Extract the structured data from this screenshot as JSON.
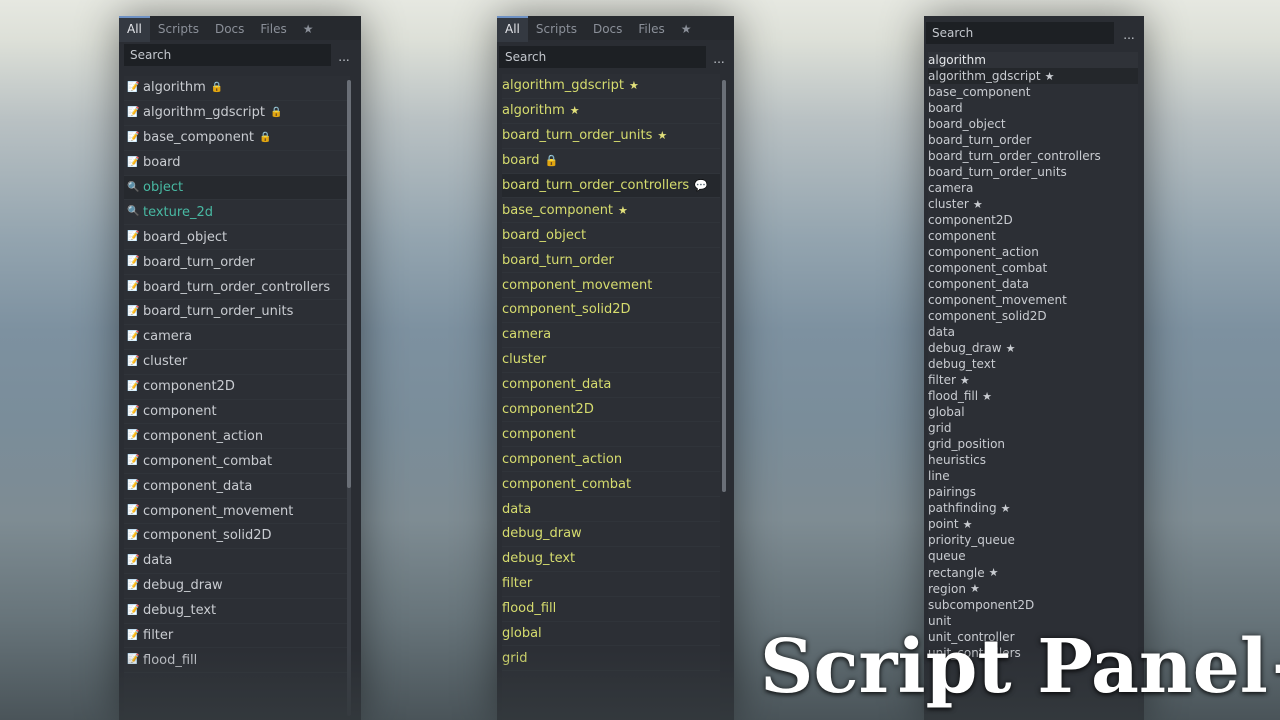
{
  "colors": {
    "panel_bg": "#2a2d33",
    "accent_tab": "#6e91c4",
    "help_teal": "#48b9a3",
    "favorite_yellow": "#d6dc6e",
    "lock_gold": "#e5c451"
  },
  "brand_title": "Script Panel+",
  "panels": [
    {
      "tabs": [
        "All",
        "Scripts",
        "Docs",
        "Files",
        "★"
      ],
      "active_tab": "All",
      "search_placeholder": "Search",
      "menu_label": "...",
      "items": [
        {
          "label": "algorithm",
          "icon": "script-icon",
          "mark": "🔒"
        },
        {
          "label": "algorithm_gdscript",
          "icon": "script-icon",
          "mark": "🔒"
        },
        {
          "label": "base_component",
          "icon": "script-icon",
          "mark": "🔒"
        },
        {
          "label": "board",
          "icon": "script-icon",
          "mark": ""
        },
        {
          "label": "object",
          "icon": "help-search-icon",
          "mark": "",
          "type": "help",
          "selected": true
        },
        {
          "label": "texture_2d",
          "icon": "help-search-icon",
          "mark": "",
          "type": "help"
        },
        {
          "label": "board_object",
          "icon": "script-icon",
          "mark": ""
        },
        {
          "label": "board_turn_order",
          "icon": "script-icon",
          "mark": ""
        },
        {
          "label": "board_turn_order_controllers",
          "icon": "script-icon",
          "mark": ""
        },
        {
          "label": "board_turn_order_units",
          "icon": "script-icon",
          "mark": ""
        },
        {
          "label": "camera",
          "icon": "script-icon",
          "mark": ""
        },
        {
          "label": "cluster",
          "icon": "script-icon",
          "mark": ""
        },
        {
          "label": "component2D",
          "icon": "script-icon",
          "mark": ""
        },
        {
          "label": "component",
          "icon": "script-icon",
          "mark": ""
        },
        {
          "label": "component_action",
          "icon": "script-icon",
          "mark": ""
        },
        {
          "label": "component_combat",
          "icon": "script-icon",
          "mark": ""
        },
        {
          "label": "component_data",
          "icon": "script-icon",
          "mark": ""
        },
        {
          "label": "component_movement",
          "icon": "script-icon",
          "mark": ""
        },
        {
          "label": "component_solid2D",
          "icon": "script-icon",
          "mark": ""
        },
        {
          "label": "data",
          "icon": "script-icon",
          "mark": ""
        },
        {
          "label": "debug_draw",
          "icon": "script-icon",
          "mark": ""
        },
        {
          "label": "debug_text",
          "icon": "script-icon",
          "mark": ""
        },
        {
          "label": "filter",
          "icon": "script-icon",
          "mark": ""
        },
        {
          "label": "flood_fill",
          "icon": "script-icon",
          "mark": ""
        }
      ]
    },
    {
      "tabs": [
        "All",
        "Scripts",
        "Docs",
        "Files",
        "★"
      ],
      "active_tab": "All",
      "search_placeholder": "Search",
      "menu_label": "...",
      "items": [
        {
          "label": "algorithm_gdscript",
          "mark": "★"
        },
        {
          "label": "algorithm",
          "mark": "★"
        },
        {
          "label": "board_turn_order_units",
          "mark": "★"
        },
        {
          "label": "board",
          "mark": "🔒"
        },
        {
          "label": "board_turn_order_controllers",
          "mark": "💬",
          "selected": true
        },
        {
          "label": "base_component",
          "mark": "★"
        },
        {
          "label": "board_object",
          "mark": ""
        },
        {
          "label": "board_turn_order",
          "mark": ""
        },
        {
          "label": "component_movement",
          "mark": ""
        },
        {
          "label": "component_solid2D",
          "mark": ""
        },
        {
          "label": "camera",
          "mark": ""
        },
        {
          "label": "cluster",
          "mark": ""
        },
        {
          "label": "component_data",
          "mark": ""
        },
        {
          "label": "component2D",
          "mark": ""
        },
        {
          "label": "component",
          "mark": ""
        },
        {
          "label": "component_action",
          "mark": ""
        },
        {
          "label": "component_combat",
          "mark": ""
        },
        {
          "label": "data",
          "mark": ""
        },
        {
          "label": "debug_draw",
          "mark": ""
        },
        {
          "label": "debug_text",
          "mark": ""
        },
        {
          "label": "filter",
          "mark": ""
        },
        {
          "label": "flood_fill",
          "mark": ""
        },
        {
          "label": "global",
          "mark": ""
        },
        {
          "label": "grid",
          "mark": ""
        }
      ]
    },
    {
      "search_placeholder": "Search",
      "menu_label": "...",
      "items": [
        {
          "label": "algorithm",
          "mark": "",
          "type": "head"
        },
        {
          "label": "algorithm_gdscript",
          "mark": "★",
          "selected": true
        },
        {
          "label": "base_component",
          "mark": ""
        },
        {
          "label": "board",
          "mark": ""
        },
        {
          "label": "board_object",
          "mark": ""
        },
        {
          "label": "board_turn_order",
          "mark": ""
        },
        {
          "label": "board_turn_order_controllers",
          "mark": ""
        },
        {
          "label": "board_turn_order_units",
          "mark": ""
        },
        {
          "label": "camera",
          "mark": ""
        },
        {
          "label": "cluster",
          "mark": "★"
        },
        {
          "label": "component2D",
          "mark": ""
        },
        {
          "label": "component",
          "mark": ""
        },
        {
          "label": "component_action",
          "mark": ""
        },
        {
          "label": "component_combat",
          "mark": ""
        },
        {
          "label": "component_data",
          "mark": ""
        },
        {
          "label": "component_movement",
          "mark": ""
        },
        {
          "label": "component_solid2D",
          "mark": ""
        },
        {
          "label": "data",
          "mark": ""
        },
        {
          "label": "debug_draw",
          "mark": "★"
        },
        {
          "label": "debug_text",
          "mark": ""
        },
        {
          "label": "filter",
          "mark": "★"
        },
        {
          "label": "flood_fill",
          "mark": "★"
        },
        {
          "label": "global",
          "mark": ""
        },
        {
          "label": "grid",
          "mark": ""
        },
        {
          "label": "grid_position",
          "mark": ""
        },
        {
          "label": "heuristics",
          "mark": ""
        },
        {
          "label": "line",
          "mark": ""
        },
        {
          "label": "pairings",
          "mark": ""
        },
        {
          "label": "pathfinding",
          "mark": "★"
        },
        {
          "label": "point",
          "mark": "★"
        },
        {
          "label": "priority_queue",
          "mark": ""
        },
        {
          "label": "queue",
          "mark": ""
        },
        {
          "label": "rectangle",
          "mark": "★"
        },
        {
          "label": "region",
          "mark": "★"
        },
        {
          "label": "subcomponent2D",
          "mark": ""
        },
        {
          "label": "unit",
          "mark": ""
        },
        {
          "label": "unit_controller",
          "mark": ""
        },
        {
          "label": "unit_controllers",
          "mark": ""
        }
      ]
    }
  ]
}
